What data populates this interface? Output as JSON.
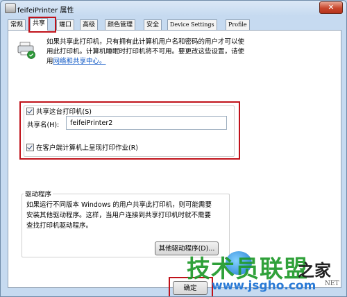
{
  "window": {
    "title": "feifeiPrinter 属性",
    "close_glyph": "✕"
  },
  "tabs": [
    {
      "label": "常规"
    },
    {
      "label": "共享",
      "active": true
    },
    {
      "label": "端口"
    },
    {
      "label": "高级"
    },
    {
      "label": "颜色管理"
    },
    {
      "label": "安全"
    },
    {
      "label": "Device Settings"
    },
    {
      "label": "Profile"
    }
  ],
  "share_page": {
    "description_line1": "如果共享此打印机，只有拥有此计算机用户名和密码的用户才可以使",
    "description_line2": "用此打印机。计算机睡眠时打印机将不可用。要更改这些设置，请使",
    "description_line3_prefix": "用",
    "network_center_link": "网络和共享中心。",
    "share_checkbox_label": "共享这台打印机(S)",
    "share_checked": true,
    "share_name_label": "共享名(H):",
    "share_name_value": "feifeiPrinter2",
    "render_jobs_label": "在客户端计算机上呈现打印作业(R)",
    "render_jobs_checked": true
  },
  "drivers": {
    "legend": "驱动程序",
    "description": "如果运行不同版本 Windows 的用户共享此打印机，则可能需要安装其他驱动程序。这样，当用户连接到共享打印机时就不需要查找打印机驱动程序。",
    "other_drivers_button": "其他驱动程序(D)..."
  },
  "footer": {
    "ok_button": "确定"
  },
  "watermark": {
    "brand_cn": "技术员联盟",
    "brand_cn2": "之家",
    "url": "www.jsgho.com",
    "net": "NET"
  },
  "colors": {
    "highlight_red": "#c0121a",
    "link_blue": "#0b55c4"
  }
}
